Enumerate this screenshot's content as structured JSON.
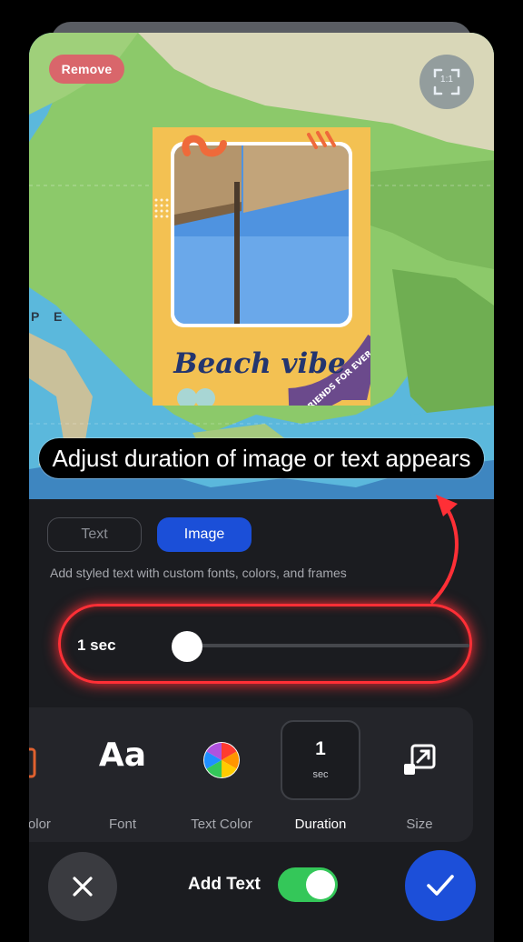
{
  "preview": {
    "remove_label": "Remove",
    "ratio_label": "1:1",
    "map_letters": "P E",
    "sticker_title": "Beach vibe",
    "sticker_badge": "FRIENDS FOR EVER",
    "caption": "Adjust duration of image or text appears"
  },
  "tabs": [
    {
      "label": "Text",
      "active": false
    },
    {
      "label": "Image",
      "active": true
    }
  ],
  "hint": "Add styled text with custom fonts, colors, and frames",
  "slider": {
    "label": "1 sec",
    "value": 0
  },
  "tools": [
    {
      "label": "Color",
      "icon": "color-swatch-icon",
      "active": false
    },
    {
      "label": "Font",
      "icon": "font-icon",
      "glyph": "Aa",
      "active": false
    },
    {
      "label": "Text Color",
      "icon": "color-wheel-icon",
      "active": false
    },
    {
      "label": "Duration",
      "value": "1",
      "unit": "sec",
      "active": true
    },
    {
      "label": "Size",
      "icon": "resize-icon",
      "active": false
    }
  ],
  "bottom": {
    "add_text_label": "Add Text",
    "add_text_on": true
  },
  "colors": {
    "accent": "#1c4fd9",
    "highlight": "#ff2f36",
    "toggle": "#34c759",
    "remove": "#d9666b"
  }
}
